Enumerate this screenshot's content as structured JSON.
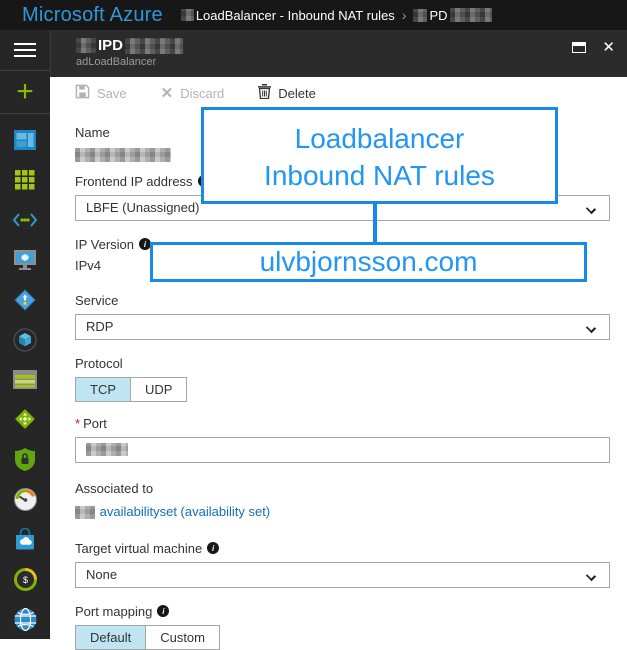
{
  "topbar": {
    "brand": "Microsoft Azure",
    "breadcrumb": {
      "loadbalancer": "LoadBalancer - Inbound NAT rules",
      "separator": "›",
      "current_visible": "PD"
    }
  },
  "sidebar": {
    "items": [
      {
        "name": "menu-icon"
      },
      {
        "name": "new-plus-icon"
      },
      {
        "name": "dashboard-icon"
      },
      {
        "name": "all-resources-grid-icon"
      },
      {
        "name": "resource-groups-braces-icon"
      },
      {
        "name": "virtual-machines-monitor-icon"
      },
      {
        "name": "availability-set-diamond-icon"
      },
      {
        "name": "cube-icon"
      },
      {
        "name": "subscriptions-window-icon"
      },
      {
        "name": "traffic-manager-diamond-icon"
      },
      {
        "name": "security-center-shield-icon"
      },
      {
        "name": "monitor-gauge-icon"
      },
      {
        "name": "marketplace-bag-icon"
      },
      {
        "name": "cost-management-icon"
      },
      {
        "name": "virtual-network-globe-icon"
      }
    ]
  },
  "panel": {
    "header": {
      "title_visible": "IPD",
      "subtitle": "adLoadBalancer"
    },
    "toolbar": {
      "save": "Save",
      "discard": "Discard",
      "delete": "Delete"
    },
    "form": {
      "name_label": "Name",
      "frontend_label": "Frontend IP address",
      "frontend_value": "LBFE (Unassigned)",
      "ip_version_label": "IP Version",
      "ip_version_value": "IPv4",
      "service_label": "Service",
      "service_value": "RDP",
      "protocol_label": "Protocol",
      "protocol_options": {
        "0": "TCP",
        "1": "UDP"
      },
      "protocol_selected": "TCP",
      "port_label": "Port",
      "required_marker": "*",
      "associated_label": "Associated to",
      "associated_link_visible": "availabilityset (availability set)",
      "target_label": "Target virtual machine",
      "target_value": "None",
      "port_mapping_label": "Port mapping",
      "port_mapping_options": {
        "0": "Default",
        "1": "Custom"
      },
      "port_mapping_selected": "Default"
    }
  },
  "annotation": {
    "title_line1": "Loadbalancer",
    "title_line2": "Inbound NAT rules",
    "watermark": "ulvbjornsson.com",
    "accent_color": "#1789e8",
    "text_color": "#2196f3"
  },
  "colors": {
    "topbar_bg": "#171717",
    "sidebar_bg": "#262626",
    "panel_header_bg": "#2b2b2b",
    "brand_blue": "#3196d9",
    "toggle_selected_bg": "#bfe5f2",
    "link_blue": "#1170b8",
    "required_red": "#e81123",
    "plus_green": "#86bc00"
  }
}
